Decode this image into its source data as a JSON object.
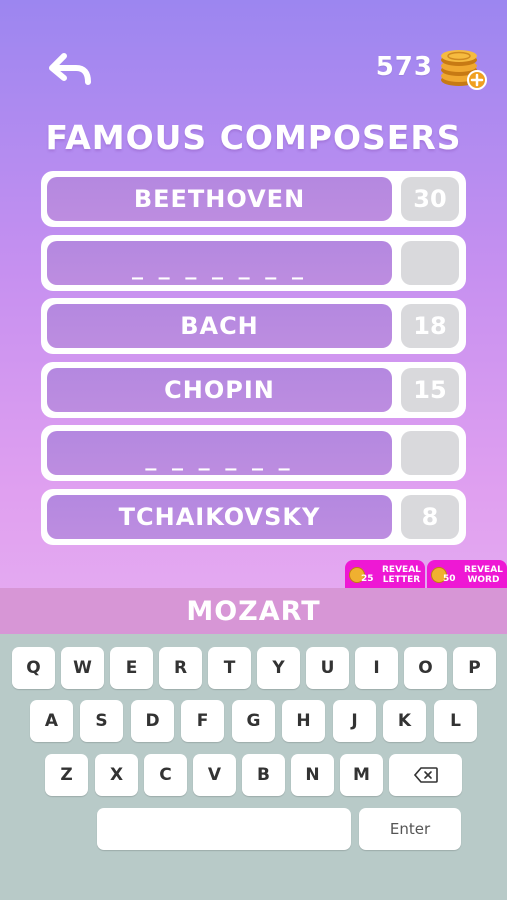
{
  "header": {
    "coin_count": "573",
    "back_icon": "back-arrow-icon",
    "coin_icon": "coin-stack-icon"
  },
  "title": "Famous Composers",
  "answers": [
    {
      "word": "Beethoven",
      "score": "30",
      "revealed": true
    },
    {
      "word": "_ _ _ _ _ _ _",
      "score": "",
      "revealed": false
    },
    {
      "word": "Bach",
      "score": "18",
      "revealed": true
    },
    {
      "word": "Chopin",
      "score": "15",
      "revealed": true
    },
    {
      "word": "_ _ _ _ _ _",
      "score": "",
      "revealed": false
    },
    {
      "word": "Tchaikovsky",
      "score": "8",
      "revealed": true
    }
  ],
  "hints": {
    "reveal_letter": {
      "cost": "25",
      "label_1": "Reveal",
      "label_2": "Letter"
    },
    "reveal_word": {
      "cost": "50",
      "label_1": "Reveal",
      "label_2": "Word"
    }
  },
  "current_input": "Mozart",
  "keyboard": {
    "row1": [
      "Q",
      "W",
      "E",
      "R",
      "T",
      "Y",
      "U",
      "I",
      "O",
      "P"
    ],
    "row2": [
      "A",
      "S",
      "D",
      "F",
      "G",
      "H",
      "J",
      "K",
      "L"
    ],
    "row3": [
      "Z",
      "X",
      "C",
      "V",
      "B",
      "N",
      "M"
    ],
    "enter_label": "Enter",
    "backspace_icon": "backspace-icon"
  },
  "colors": {
    "accent": "#ee18d4",
    "word_box": "#b98ae0",
    "score_box": "#d9d9dc",
    "input_bar": "#d796d6",
    "keyboard_bg": "#b8cac8"
  }
}
